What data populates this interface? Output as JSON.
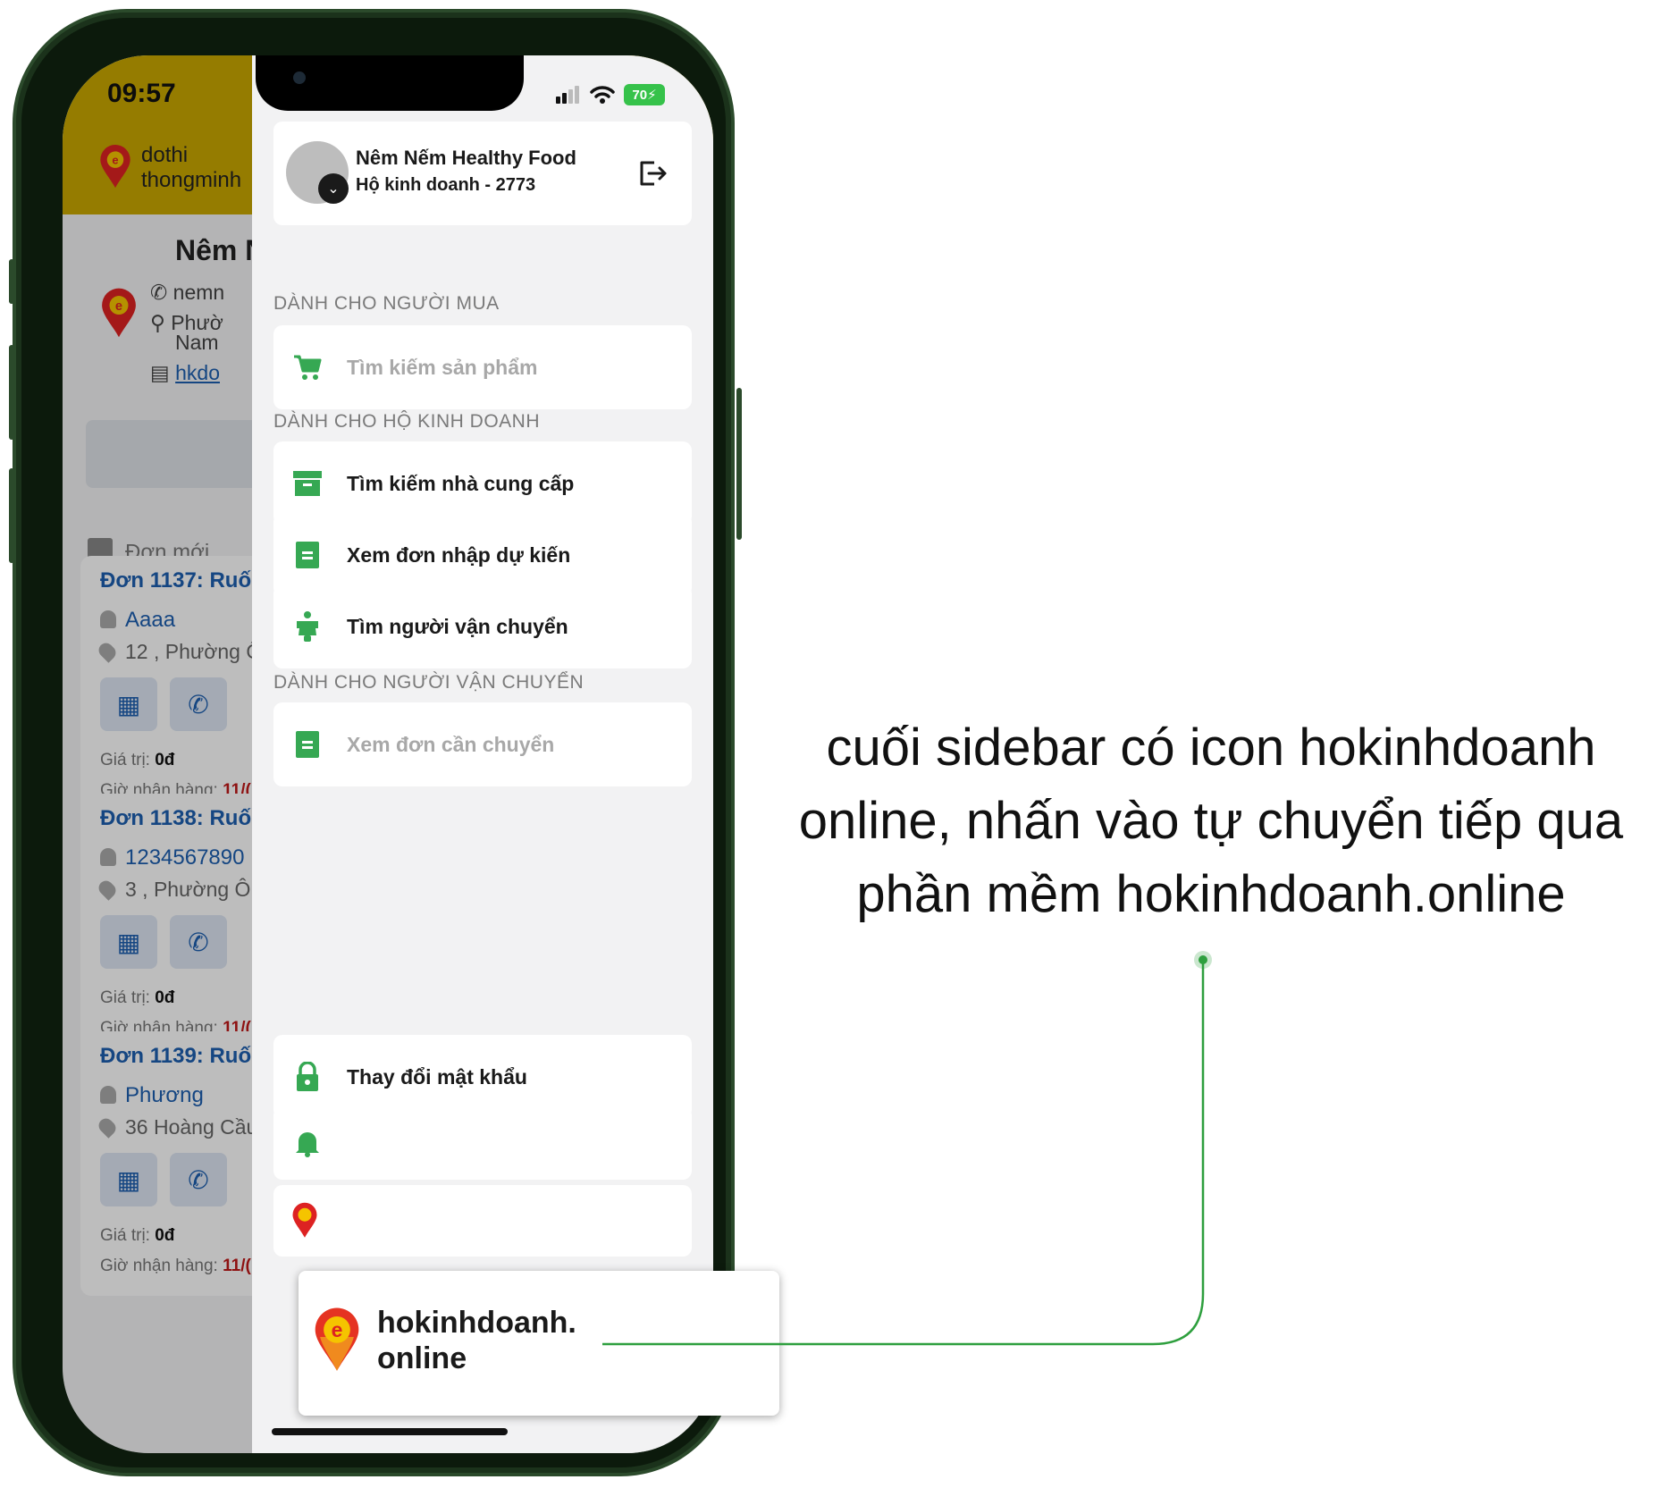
{
  "status_bar": {
    "time": "09:57",
    "battery": "70"
  },
  "background_app": {
    "brand": {
      "line1": "dothi",
      "line2": "thongminh"
    },
    "profile": {
      "name_partial": "Nêm N",
      "phone_partial": "nemn",
      "address_partial_1": "Phườ",
      "address_partial_2": "Nam",
      "link_partial": "hkdo"
    },
    "tab_new_orders": "Đơn mới",
    "orders": [
      {
        "title": "Đơn 1137:  Ruốc",
        "customer": "Aaaa",
        "address": "12 , Phường Ô",
        "value_label": "Giá trị:",
        "value": "0đ",
        "time_label": "Giờ nhận hàng:",
        "time": "11/("
      },
      {
        "title": "Đơn 1138:  Ruốc",
        "customer": "1234567890",
        "address": "3 , Phường Ô (",
        "value_label": "Giá trị:",
        "value": "0đ",
        "time_label": "Giờ nhận hàng:",
        "time": "11/("
      },
      {
        "title": "Đơn 1139:  Ruốc",
        "customer": "Phương",
        "address": "36 Hoàng Cầu",
        "value_label": "Giá trị:",
        "value": "0đ",
        "time_label": "Giờ nhận hàng:",
        "time": "11/("
      }
    ]
  },
  "sidebar": {
    "profile": {
      "name": "Nêm Nếm Healthy Food",
      "subtitle": "Hộ kinh doanh - 2773"
    },
    "sections": [
      {
        "label": "DÀNH CHO NGƯỜI MUA",
        "items": [
          {
            "label": "Tìm kiếm sản phẩm",
            "icon": "cart-icon",
            "disabled": true
          }
        ]
      },
      {
        "label": "DÀNH CHO HỘ KINH DOANH",
        "items": [
          {
            "label": "Tìm kiếm nhà cung cấp",
            "icon": "archive-icon",
            "disabled": false
          },
          {
            "label": "Xem đơn nhập dự kiến",
            "icon": "document-icon",
            "disabled": false
          },
          {
            "label": "Tìm người vận chuyển",
            "icon": "scooter-icon",
            "disabled": false
          }
        ]
      },
      {
        "label": "DÀNH CHO NGƯỜI VẬN CHUYỂN",
        "items": [
          {
            "label": "Xem đơn cần chuyển",
            "icon": "document-icon",
            "disabled": true
          }
        ]
      }
    ],
    "bottom_items": [
      {
        "label": "Thay đổi mật khẩu",
        "icon": "lock-icon"
      }
    ]
  },
  "callout": {
    "line1": "hokinhdoanh.",
    "line2": "online"
  },
  "annotation": {
    "line1": "cuối sidebar có icon hokinhdoanh",
    "line2": "online, nhấn vào tự chuyển tiếp qua",
    "line3": "phần mềm hokinhdoanh.online"
  },
  "colors": {
    "accent_green": "#36a853",
    "header_yellow": "#c9a800",
    "link_blue": "#1d5fb0",
    "date_red": "#c01717"
  }
}
